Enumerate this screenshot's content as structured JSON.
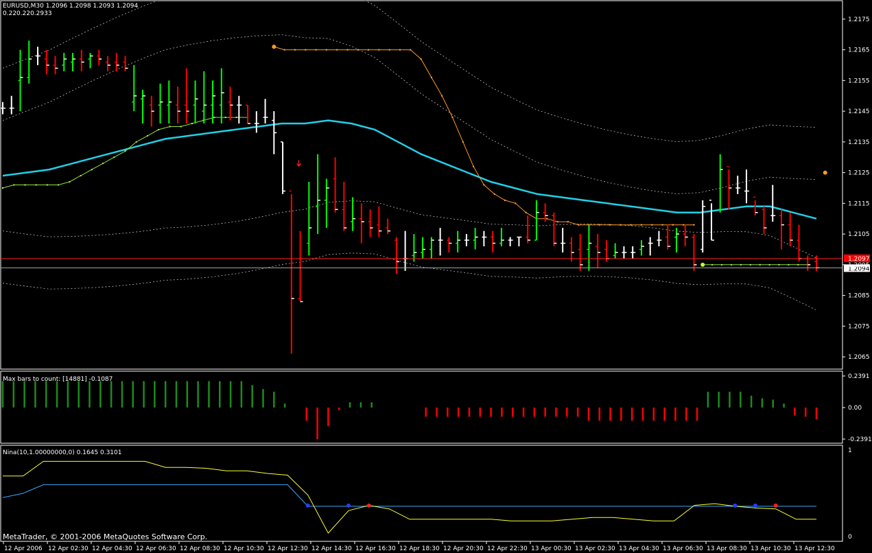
{
  "chart_data": {
    "type": "ohlc",
    "header": {
      "symbol_line": "EURUSD,M30  1.2096 1.2098 1.2093 1.2094",
      "sub_line": "0.220.220.2933"
    },
    "price_axis": {
      "ticks": [
        "1.2175",
        "1.2165",
        "1.2155",
        "1.2145",
        "1.2135",
        "1.2125",
        "1.2115",
        "1.2105",
        "1.2095",
        "1.2085",
        "1.2075",
        "1.2065"
      ],
      "ylim": [
        1.2061,
        1.2181
      ]
    },
    "tags": {
      "red_line": "1.2097",
      "current": "1.2094"
    },
    "colors": {
      "up": "#00ff00",
      "down": "#ff0000",
      "neutral": "#ffffff",
      "ma": "#20d0e8",
      "sar": "#ff9a20",
      "trail": "#90e040",
      "grid": "#888888"
    },
    "time_labels": [
      "12 Apr 2006",
      "12 Apr 02:30",
      "12 Apr 04:30",
      "12 Apr 06:30",
      "12 Apr 08:30",
      "12 Apr 10:30",
      "12 Apr 12:30",
      "12 Apr 14:30",
      "12 Apr 16:30",
      "12 Apr 18:30",
      "12 Apr 20:30",
      "12 Apr 22:30",
      "13 Apr 00:30",
      "13 Apr 02:30",
      "13 Apr 04:30",
      "13 Apr 06:30",
      "13 Apr 08:30",
      "13 Apr 10:30",
      "13 Apr 12:30"
    ],
    "bars": [
      [
        1.2146,
        1.2148,
        1.2144,
        1.2146
      ],
      [
        1.2146,
        1.215,
        1.2144,
        1.2146
      ],
      [
        1.2155,
        1.2165,
        1.2145,
        1.2156
      ],
      [
        1.2156,
        1.2168,
        1.2154,
        1.2162
      ],
      [
        1.2163,
        1.2166,
        1.216,
        1.2163
      ],
      [
        1.2162,
        1.2165,
        1.2157,
        1.216
      ],
      [
        1.216,
        1.2163,
        1.2157,
        1.2159
      ],
      [
        1.216,
        1.2164,
        1.2158,
        1.2162
      ],
      [
        1.2161,
        1.2164,
        1.2158,
        1.2162
      ],
      [
        1.2162,
        1.2165,
        1.2158,
        1.2161
      ],
      [
        1.2162,
        1.2164,
        1.2159,
        1.2163
      ],
      [
        1.2163,
        1.2165,
        1.216,
        1.2162
      ],
      [
        1.2161,
        1.2163,
        1.2158,
        1.216
      ],
      [
        1.2161,
        1.2164,
        1.2158,
        1.216
      ],
      [
        1.2161,
        1.2163,
        1.2158,
        1.2159
      ],
      [
        1.2148,
        1.216,
        1.2145,
        1.215
      ],
      [
        1.2149,
        1.2152,
        1.2141,
        1.215
      ],
      [
        1.2147,
        1.215,
        1.214,
        1.2145
      ],
      [
        1.2147,
        1.2154,
        1.2141,
        1.2148
      ],
      [
        1.2147,
        1.2155,
        1.2141,
        1.2148
      ],
      [
        1.2147,
        1.2153,
        1.2141,
        1.2145
      ],
      [
        1.2147,
        1.2159,
        1.2141,
        1.2145
      ],
      [
        1.2147,
        1.2155,
        1.2141,
        1.2149
      ],
      [
        1.2145,
        1.2158,
        1.2141,
        1.2147
      ],
      [
        1.2147,
        1.2155,
        1.2141,
        1.215
      ],
      [
        1.2147,
        1.2159,
        1.2141,
        1.2151
      ],
      [
        1.2148,
        1.2153,
        1.2142,
        1.2147
      ],
      [
        1.2147,
        1.215,
        1.2141,
        1.2147
      ],
      [
        1.2147,
        1.2147,
        1.2141,
        1.2141
      ],
      [
        1.2141,
        1.2145,
        1.2138,
        1.2141
      ],
      [
        1.2143,
        1.2149,
        1.2141,
        1.2143
      ],
      [
        1.2142,
        1.2145,
        1.2131,
        1.2138
      ],
      [
        1.2135,
        1.2135,
        1.2118,
        1.2119
      ],
      [
        1.2119,
        1.2118,
        1.2066,
        1.2084
      ],
      [
        1.2084,
        1.2106,
        1.2083,
        1.2083
      ],
      [
        1.2102,
        1.2122,
        1.2098,
        1.2107
      ],
      [
        1.2114,
        1.2131,
        1.2105,
        1.2116
      ],
      [
        1.2116,
        1.2123,
        1.2107,
        1.212
      ],
      [
        1.2123,
        1.213,
        1.2112,
        1.2113
      ],
      [
        1.2113,
        1.2122,
        1.2106,
        1.2107
      ],
      [
        1.2109,
        1.2117,
        1.2106,
        1.211
      ],
      [
        1.211,
        1.2115,
        1.2102,
        1.2109
      ],
      [
        1.2109,
        1.2113,
        1.2104,
        1.2107
      ],
      [
        1.2108,
        1.2114,
        1.2104,
        1.2106
      ],
      [
        1.2107,
        1.211,
        1.2105,
        1.2106
      ],
      [
        1.2103,
        1.2104,
        1.2092,
        1.2096
      ],
      [
        1.2097,
        1.2106,
        1.2093,
        1.2097
      ],
      [
        1.2098,
        1.2105,
        1.2096,
        1.2099
      ],
      [
        1.2099,
        1.2104,
        1.2097,
        1.21
      ],
      [
        1.21,
        1.2104,
        1.2097,
        1.2103
      ],
      [
        1.2103,
        1.2107,
        1.2098,
        1.2103
      ],
      [
        1.2103,
        1.2104,
        1.2099,
        1.2102
      ],
      [
        1.2102,
        1.2106,
        1.2099,
        1.2103
      ],
      [
        1.2103,
        1.2105,
        1.2101,
        1.2103
      ],
      [
        1.2103,
        1.2107,
        1.21,
        1.2104
      ],
      [
        1.2104,
        1.2106,
        1.2101,
        1.2104
      ],
      [
        1.2104,
        1.2106,
        1.2099,
        1.2102
      ],
      [
        1.2102,
        1.2107,
        1.2101,
        1.2103
      ],
      [
        1.2103,
        1.2104,
        1.2101,
        1.2103
      ],
      [
        1.2104,
        1.2101,
        1.2104,
        1.2104
      ],
      [
        1.2104,
        1.2111,
        1.2102,
        1.2103
      ],
      [
        1.2103,
        1.2116,
        1.2103,
        1.2112
      ],
      [
        1.2112,
        1.2115,
        1.2109,
        1.2111
      ],
      [
        1.2111,
        1.2112,
        1.2101,
        1.2102
      ],
      [
        1.2102,
        1.2107,
        1.2099,
        1.2102
      ],
      [
        1.2102,
        1.2104,
        1.2096,
        1.2099
      ],
      [
        1.21,
        1.2105,
        1.2093,
        1.2095
      ],
      [
        1.21,
        1.2108,
        1.2093,
        1.2102
      ],
      [
        1.2101,
        1.2105,
        1.2094,
        1.2099
      ],
      [
        1.21,
        1.2103,
        1.2096,
        1.2097
      ],
      [
        1.2098,
        1.2102,
        1.2097,
        1.2099
      ],
      [
        1.2099,
        1.2101,
        1.2097,
        1.2099
      ],
      [
        1.2099,
        1.2101,
        1.2097,
        1.2099
      ],
      [
        1.21,
        1.2103,
        1.2098,
        1.2101
      ],
      [
        1.2102,
        1.2104,
        1.2098,
        1.2102
      ],
      [
        1.2103,
        1.2106,
        1.2101,
        1.2103
      ],
      [
        1.2104,
        1.2108,
        1.21,
        1.2101
      ],
      [
        1.2104,
        1.2107,
        1.2099,
        1.2105
      ],
      [
        1.2105,
        1.2108,
        1.2101,
        1.2104
      ],
      [
        1.2104,
        1.2105,
        1.2093,
        1.2095
      ],
      [
        1.21,
        1.2116,
        1.2099,
        1.2114
      ],
      [
        1.2116,
        1.2115,
        1.2103,
        1.2103
      ],
      [
        1.2113,
        1.2131,
        1.2112,
        1.2126
      ],
      [
        1.2127,
        1.2126,
        1.2113,
        1.212
      ],
      [
        1.212,
        1.2124,
        1.2118,
        1.212
      ],
      [
        1.2119,
        1.2126,
        1.2115,
        1.2119
      ],
      [
        1.2117,
        1.2116,
        1.2111,
        1.2112
      ],
      [
        1.2113,
        1.2114,
        1.2105,
        1.2107
      ],
      [
        1.2111,
        1.2121,
        1.2109,
        1.2111
      ],
      [
        1.2111,
        1.2113,
        1.21,
        1.2108
      ],
      [
        1.2108,
        1.2112,
        1.2101,
        1.2103
      ],
      [
        1.2103,
        1.2108,
        1.2096,
        1.2097
      ],
      [
        1.2097,
        1.2098,
        1.2093,
        1.2095
      ],
      [
        1.2096,
        1.2098,
        1.2093,
        1.2094
      ]
    ],
    "ma_series": [
      1.2124,
      1.2125,
      1.2126,
      1.2128,
      1.213,
      1.2132,
      1.2134,
      1.2136,
      1.2137,
      1.2138,
      1.2139,
      1.214,
      1.2141,
      1.2141,
      1.2142,
      1.2141,
      1.2139,
      1.2135,
      1.2131,
      1.2128,
      1.2125,
      1.2122,
      1.212,
      1.2118,
      1.2117,
      1.2116,
      1.2115,
      1.2114,
      1.2113,
      1.2112,
      1.2112,
      1.2113,
      1.2114,
      1.2114,
      1.2112,
      1.211
    ],
    "sar_points": [
      [
        1.2166,
        1.2165,
        1.2165,
        1.2165,
        1.2165,
        1.2165,
        1.2165,
        1.2165,
        1.2165,
        1.2165,
        1.2165,
        1.2165,
        1.2165,
        1.2165,
        1.2162,
        1.2156,
        1.215,
        1.2143,
        1.2135,
        1.2127,
        1.2121,
        1.2118,
        1.2116,
        1.2115,
        1.2112,
        1.211,
        1.211,
        1.2109,
        1.2109,
        1.2108,
        1.2108,
        1.2108,
        1.2108,
        1.2108,
        1.2108,
        1.2108,
        1.2108,
        1.2108,
        1.2108,
        1.2108,
        1.2108
      ],
      [
        1.2125
      ]
    ],
    "trail_points": [
      1.212,
      1.2121,
      1.2121,
      1.2121,
      1.2121,
      1.2121,
      1.2122,
      1.2124,
      1.2126,
      1.2128,
      1.213,
      1.2132,
      1.2135,
      1.2137,
      1.2139,
      1.214,
      1.214,
      1.2141,
      1.2142,
      1.2143,
      1.2143,
      1.2143,
      1.2143
    ],
    "trail2_points": [
      1.2095,
      1.2095,
      1.2095,
      1.2095,
      1.2095,
      1.2095,
      1.2095,
      1.2095,
      1.2095,
      1.2095,
      1.2095,
      1.2095
    ],
    "sub1": {
      "label": "Max bars to count: [14881]  -0.1087",
      "ticks": [
        "0.2391",
        "0.00",
        "-0.2391"
      ],
      "ylim": [
        -0.2391,
        0.2391
      ],
      "values": [
        0.2,
        0.2,
        0.2,
        0.2,
        0.2,
        0.2,
        0.2,
        0.2,
        0.2,
        0.2,
        0.2,
        0.2,
        0.2,
        0.2,
        0.2,
        0.2,
        0.2,
        0.2,
        0.2,
        0.2,
        0.2,
        0.2,
        0.2,
        0.17,
        0.14,
        0.12,
        0.03,
        0,
        -0.1,
        -0.24,
        -0.14,
        -0.02,
        0.04,
        0.04,
        0.04,
        0,
        0,
        0,
        0,
        -0.07,
        -0.07,
        -0.07,
        -0.07,
        -0.07,
        -0.07,
        -0.07,
        -0.07,
        -0.07,
        -0.07,
        -0.07,
        -0.07,
        -0.07,
        -0.07,
        -0.07,
        -0.1,
        -0.1,
        -0.1,
        -0.1,
        -0.1,
        -0.1,
        -0.1,
        -0.1,
        -0.1,
        -0.1,
        -0.1,
        0.12,
        0.12,
        0.12,
        0.12,
        0.09,
        0.07,
        0.06,
        0.03,
        -0.06,
        -0.07,
        -0.09
      ]
    },
    "sub2": {
      "label": "Nina(10,1.00000000,0) 0.1645 0.3101",
      "ticks": [
        "1",
        "0"
      ],
      "ylim": [
        0,
        1
      ],
      "yellow": [
        0.7,
        0.7,
        0.87,
        0.87,
        0.87,
        0.87,
        0.87,
        0.87,
        0.8,
        0.8,
        0.79,
        0.76,
        0.76,
        0.73,
        0.71,
        0.48,
        0.04,
        0.3,
        0.36,
        0.32,
        0.2,
        0.2,
        0.2,
        0.2,
        0.2,
        0.18,
        0.18,
        0.18,
        0.2,
        0.22,
        0.22,
        0.2,
        0.18,
        0.18,
        0.36,
        0.38,
        0.35,
        0.33,
        0.32,
        0.2,
        0.2
      ],
      "blue": [
        0.45,
        0.5,
        0.6,
        0.6,
        0.6,
        0.6,
        0.6,
        0.6,
        0.6,
        0.6,
        0.6,
        0.6,
        0.6,
        0.6,
        0.6,
        0.35,
        0.35,
        0.35,
        0.35,
        0.35,
        0.35,
        0.35,
        0.35,
        0.35,
        0.35,
        0.35,
        0.35,
        0.35,
        0.35,
        0.35,
        0.35,
        0.35,
        0.35,
        0.35,
        0.35,
        0.35,
        0.35,
        0.35,
        0.35,
        0.35,
        0.35
      ],
      "footer": "MetaTrader, © 2001-2006 MetaQuotes Software Corp."
    }
  }
}
